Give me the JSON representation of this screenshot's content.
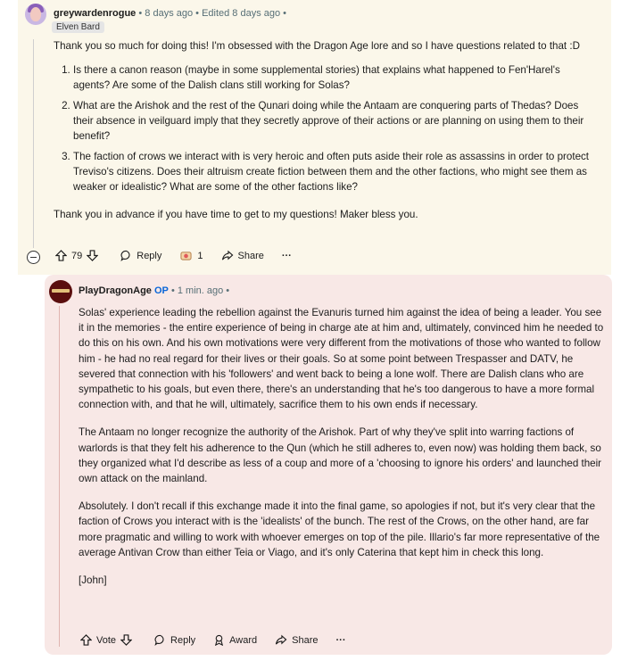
{
  "comment1": {
    "author": "greywardenrogue",
    "meta": "• 8 days ago • Edited 8 days ago •",
    "flair": "Elven Bard",
    "intro": "Thank you so much for doing this! I'm obsessed with the Dragon Age lore and so I have questions related to that :D",
    "questions": [
      "Is there a canon reason (maybe in some supplemental stories) that explains what happened to Fen'Harel's agents? Are some of the Dalish clans still working for Solas?",
      "What are the Arishok and the rest of the Qunari doing while the Antaam are conquering parts of Thedas? Does their absence in veilguard imply that they secretly approve of their actions or are planning on using them to their benefit?",
      "The faction of crows we interact with is very heroic and often puts aside their role as assassins in order to protect Treviso's citizens. Does their altruism create fiction between them and the other factions, who might see them as weaker or idealistic? What are some of the other factions like?"
    ],
    "closing": "Thank you in advance if you have time to get to my questions! Maker bless you.",
    "actions": {
      "votes": "79",
      "reply": "Reply",
      "awards": "1",
      "share": "Share",
      "more": "···"
    }
  },
  "comment2": {
    "author": "PlayDragonAge",
    "op": "OP",
    "meta": "• 1 min. ago •",
    "paragraphs": [
      "Solas' experience leading the rebellion against the Evanuris turned him against the idea of being a leader. You see it in the memories - the entire experience of being in charge ate at him and, ultimately, convinced him he needed to do this on his own. And his own motivations were very different from the motivations of those who wanted to follow him - he had no real regard for their lives or their goals. So at some point between Trespasser and DATV, he severed that connection with his 'followers' and went back to being a lone wolf. There are Dalish clans who are sympathetic to his goals, but even there, there's an understanding that he's too dangerous to have a more formal connection with, and that he will, ultimately, sacrifice them to his own ends if necessary.",
      "The Antaam no longer recognize the authority of the Arishok. Part of why they've split into warring factions of warlords is that they felt his adherence to the Qun (which he still adheres to, even now) was holding them back, so they organized what I'd describe as less of a coup and more of a 'choosing to ignore his orders' and launched their own attack on the mainland.",
      "Absolutely. I don't recall if this exchange made it into the final game, so apologies if not, but it's very clear that the faction of Crows you interact with is the 'idealists' of the bunch. The rest of the Crows, on the other hand, are far more pragmatic and willing to work with whoever emerges on top of the pile. Illario's far more representative of the average Antivan Crow than either Teia or Viago, and it's only Caterina that kept him in check this long.",
      "[John]"
    ],
    "actions": {
      "vote": "Vote",
      "reply": "Reply",
      "award": "Award",
      "share": "Share",
      "more": "···"
    }
  }
}
